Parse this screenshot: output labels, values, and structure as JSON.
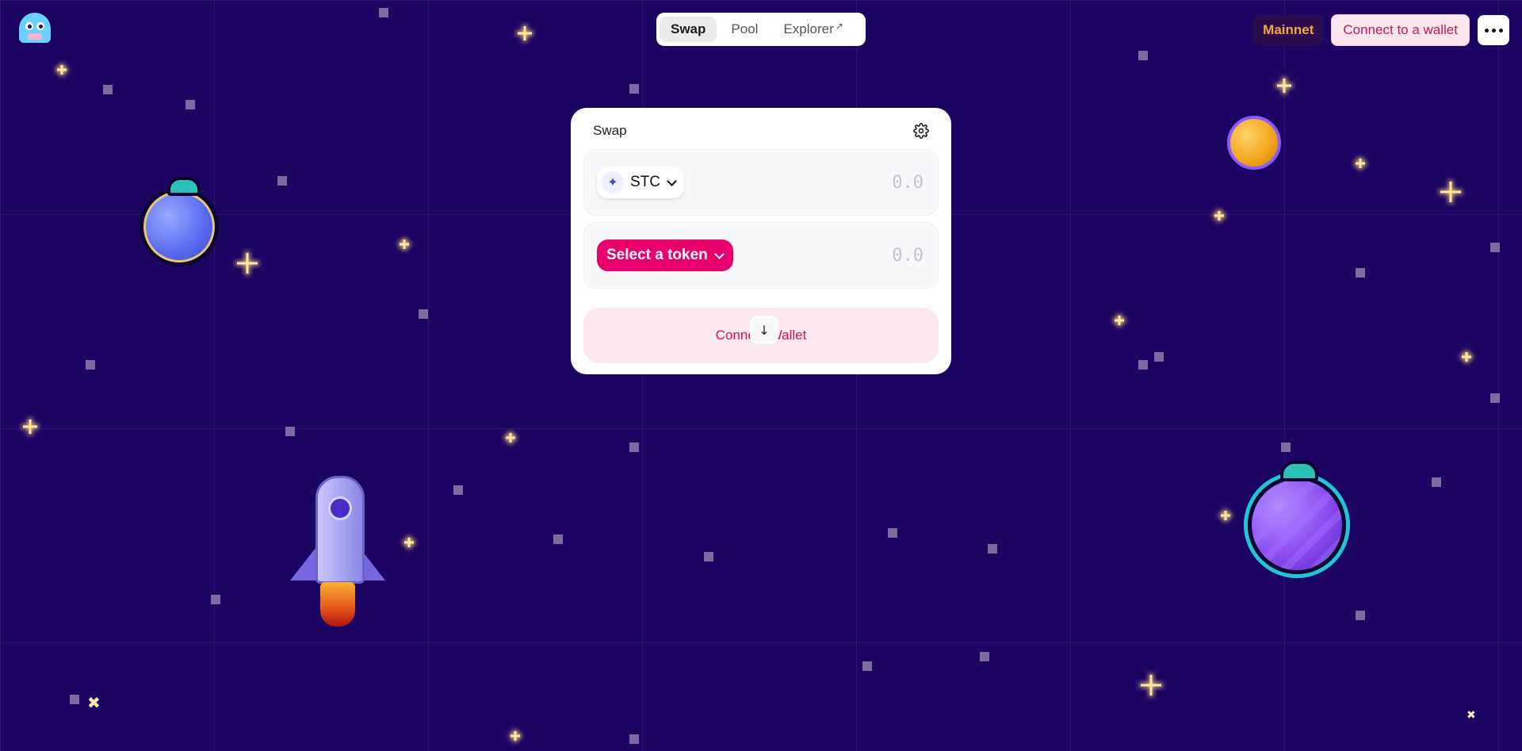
{
  "header": {
    "logo_icon": "ghost-logo-icon",
    "nav": [
      {
        "label": "Swap",
        "active": true
      },
      {
        "label": "Pool",
        "active": false
      },
      {
        "label": "Explorer",
        "active": false,
        "external_icon": "↗"
      }
    ],
    "network_label": "Mainnet",
    "connect_label": "Connect to a wallet",
    "more_icon": "more-horizontal-icon"
  },
  "swap": {
    "title": "Swap",
    "settings_icon": "gear-icon",
    "input": {
      "token_symbol": "STC",
      "placeholder": "0.0"
    },
    "direction_icon": "↓",
    "output": {
      "select_label": "Select a token",
      "placeholder": "0.0"
    },
    "connect_label": "Connect Wallet"
  },
  "colors": {
    "background": "#1c0463",
    "accent_pink": "#e8006f",
    "network": "#f3a93a"
  }
}
